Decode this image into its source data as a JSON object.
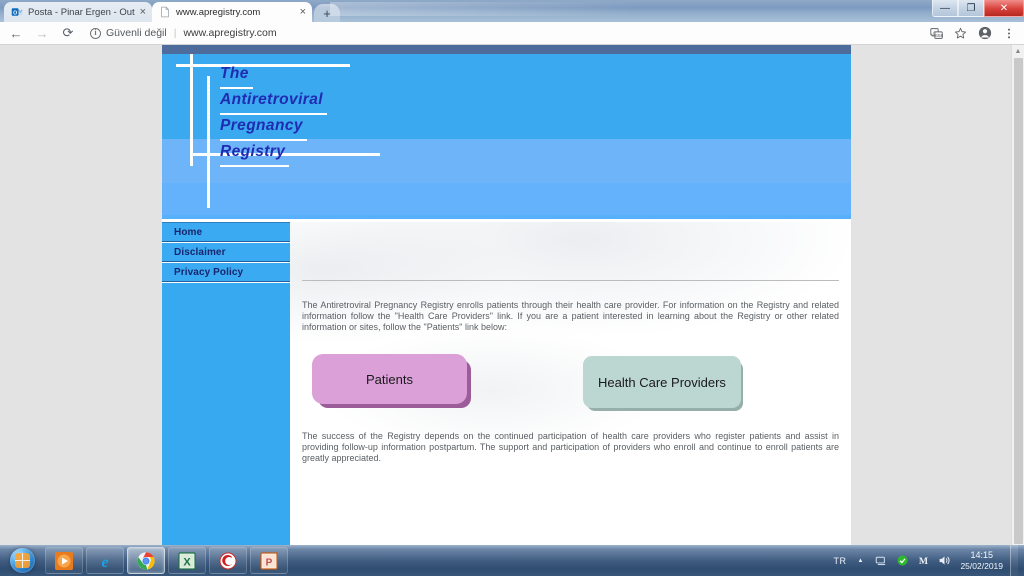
{
  "browser": {
    "tabs": [
      {
        "title": "Posta - Pinar Ergen - Outlook",
        "icon": "outlook-icon",
        "active": false,
        "close": "×"
      },
      {
        "title": "www.apregistry.com",
        "icon": "document-icon",
        "active": true,
        "close": "×"
      }
    ],
    "new_tab_label": "+",
    "window_controls": {
      "minimize": "—",
      "maximize": "❐",
      "close": "✕"
    },
    "toolbar": {
      "back_label": "←",
      "forward_label": "→",
      "reload_label": "⟳",
      "security_icon_label": "i",
      "security_text": "Güvenli değil",
      "separator": "|",
      "url": "www.apregistry.com",
      "translate_icon": "translate-icon",
      "bookmark_icon": "star-icon",
      "profile_icon": "profile-icon",
      "menu_icon": "kebab-menu-icon"
    },
    "scrollbar": {
      "up_arrow": "▲",
      "down_arrow": "▼"
    }
  },
  "page": {
    "banner": {
      "title_lines": [
        "The",
        "Antiretroviral",
        "Pregnancy",
        "Registry"
      ],
      "title_color": "#1f2bb0",
      "band_colors": [
        "#4d6c9c",
        "#3aa9f0",
        "#6db4f9"
      ]
    },
    "sidebar": {
      "items": [
        {
          "label": "Home"
        },
        {
          "label": "Disclaimer"
        },
        {
          "label": "Privacy Policy"
        }
      ],
      "background": "#36a9f0",
      "text_color": "#17256f"
    },
    "main": {
      "paragraph_1": "The Antiretroviral Pregnancy Registry enrolls patients through their health care provider. For information on the Registry and related information follow the \"Health Care Providers\" link. If you are a patient interested in learning about the Registry or other related information or sites, follow the \"Patients\" link below:",
      "paragraph_2": "The success of the Registry depends on the continued participation of health care providers who register patients and assist in providing follow-up information postpartum. The support and participation of providers who enroll and continue to enroll patients are greatly appreciated.",
      "buttons": [
        {
          "label": "Patients",
          "color": "#dba0d8",
          "shadow": "#9b5c99"
        },
        {
          "label": "Health Care Providers",
          "color": "#bcd6d2",
          "shadow": "#96afab"
        }
      ]
    }
  },
  "taskbar": {
    "start_label": "start-orb",
    "apps": [
      {
        "name": "media-player-icon",
        "selected": false
      },
      {
        "name": "internet-explorer-icon",
        "selected": false
      },
      {
        "name": "chrome-icon",
        "selected": true
      },
      {
        "name": "excel-icon",
        "selected": false
      },
      {
        "name": "red-app-icon",
        "selected": false
      },
      {
        "name": "powerpoint-icon",
        "selected": false
      }
    ],
    "tray": {
      "language": "TR",
      "chevron": "▲",
      "network_icon": "network-icon",
      "shield_icon": "shield-icon",
      "antivirus_icon": "antivirus-icon",
      "volume_icon": "volume-icon"
    },
    "clock": {
      "time": "14:15",
      "date": "25/02/2019"
    }
  }
}
